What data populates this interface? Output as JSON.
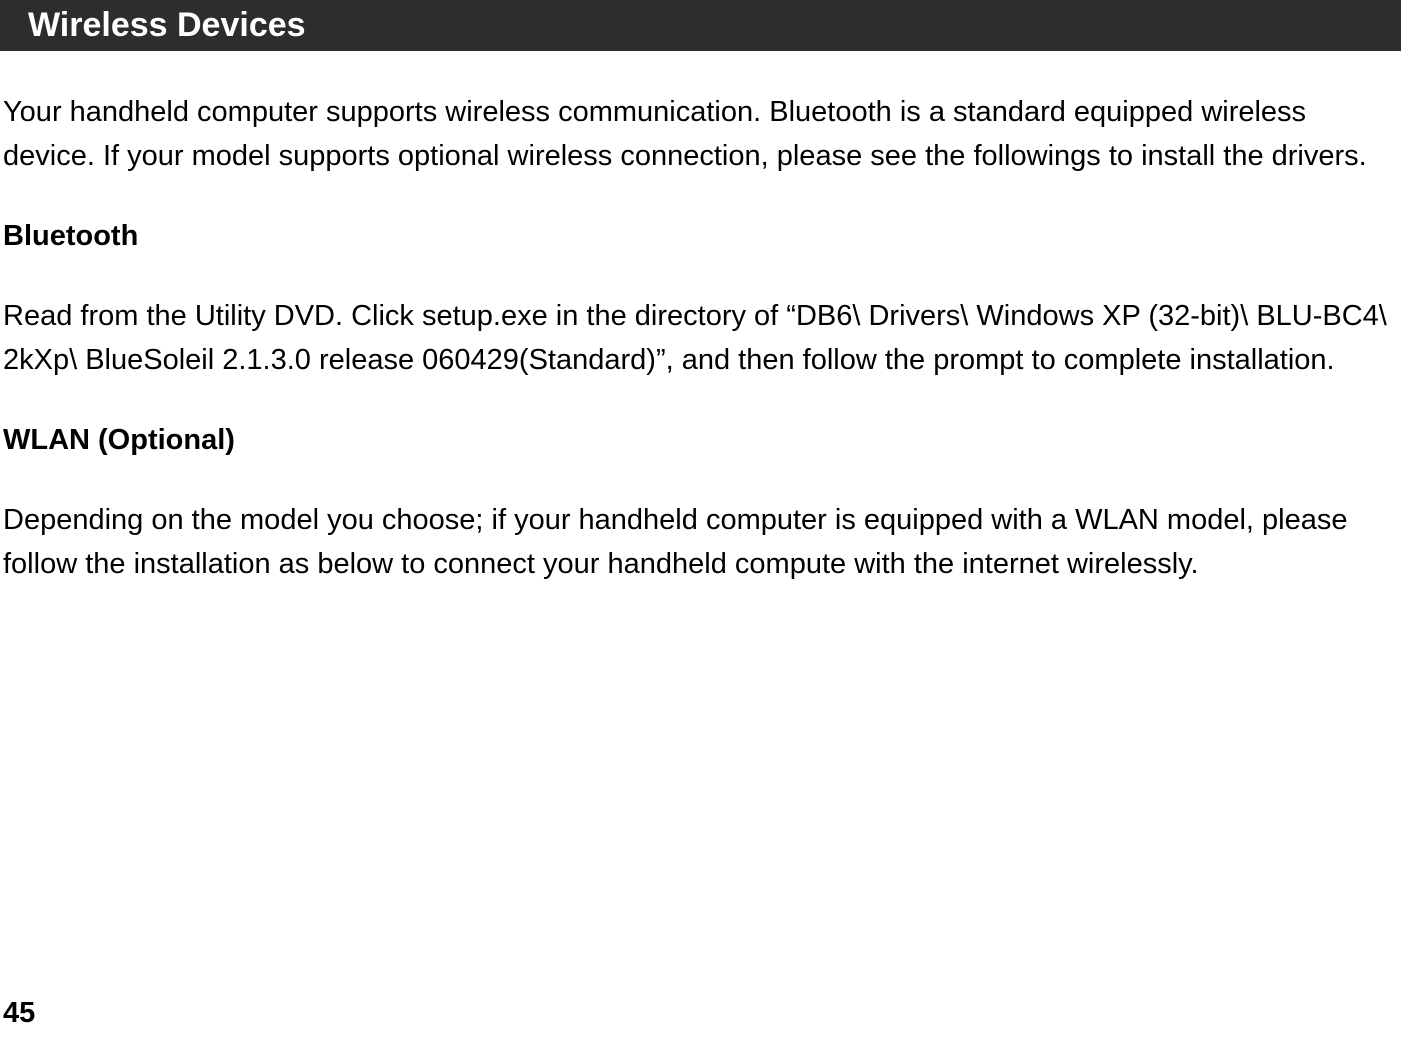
{
  "header": {
    "title": "Wireless Devices"
  },
  "intro": "Your handheld computer supports wireless communication. Bluetooth is a standard equipped wireless device. If your model supports optional wireless connection, please see the followings to install the drivers.",
  "sections": {
    "bluetooth": {
      "heading": "Bluetooth",
      "body": "Read from the Utility DVD. Click setup.exe in the directory of “DB6\\ Drivers\\ Windows XP (32-bit)\\ BLU-BC4\\ 2kXp\\ BlueSoleil 2.1.3.0 release 060429(Standard)”, and then follow the prompt to complete installation."
    },
    "wlan": {
      "heading": "WLAN (Optional)",
      "body": "Depending on the model you choose; if your handheld computer is equipped with a WLAN model, please follow the installation as below to connect your handheld compute with the internet wirelessly."
    }
  },
  "page_number": "45"
}
